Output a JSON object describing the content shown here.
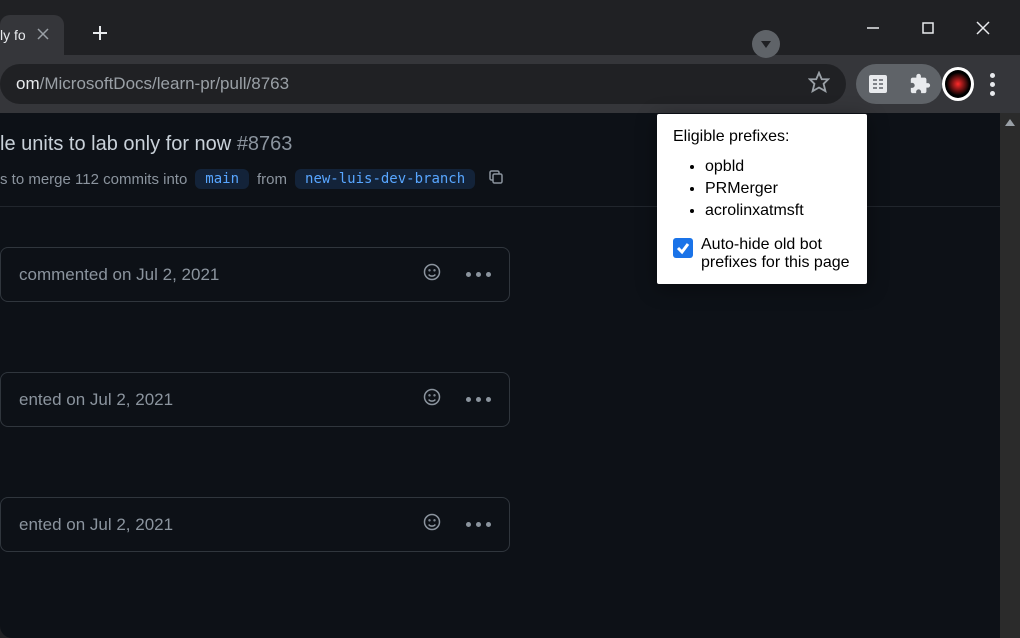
{
  "tab": {
    "title": "ly fo"
  },
  "url": {
    "visible_secondary": "om",
    "visible_path": "/MicrosoftDocs/learn-pr/pull/8763"
  },
  "pr": {
    "title": "le units to lab only for now",
    "number": "#8763",
    "meta_text": "s to merge 112 commits into",
    "base_branch": "main",
    "from_text": "from",
    "head_branch": "new-luis-dev-branch"
  },
  "timeline": {
    "items": [
      {
        "text": "commented on Jul 2, 2021"
      },
      {
        "text": "ented on Jul 2, 2021"
      },
      {
        "text": "ented on Jul 2, 2021"
      }
    ]
  },
  "popup": {
    "title": "Eligible prefixes:",
    "items": [
      "opbld",
      "PRMerger",
      "acrolinxatmsft"
    ],
    "checkbox_label": "Auto-hide old bot prefixes for this page",
    "checked": true
  }
}
